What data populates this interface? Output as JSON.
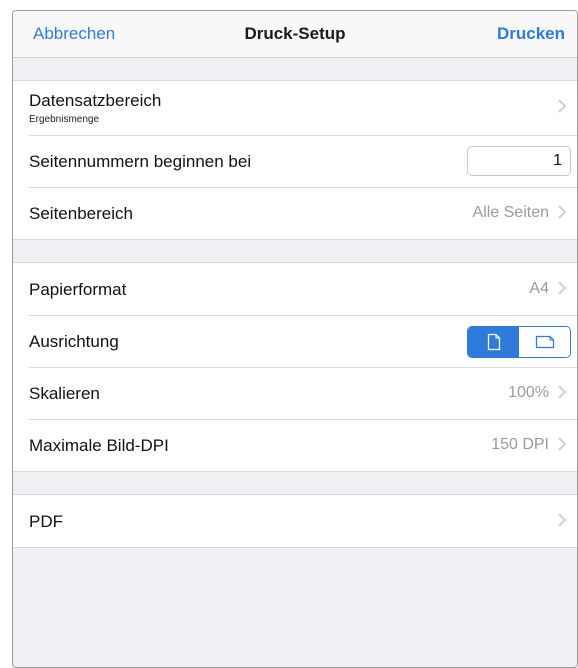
{
  "navbar": {
    "cancel_label": "Abbrechen",
    "title": "Druck-Setup",
    "print_label": "Drucken"
  },
  "section1": {
    "record_range": {
      "label": "Datensatzbereich",
      "sublabel": "Ergebnismenge"
    },
    "page_numbers_start": {
      "label": "Seitennummern beginnen bei",
      "value": "1"
    },
    "page_range": {
      "label": "Seitenbereich",
      "value": "Alle Seiten"
    }
  },
  "section2": {
    "paper_format": {
      "label": "Papierformat",
      "value": "A4"
    },
    "orientation": {
      "label": "Ausrichtung",
      "selected": "portrait",
      "options": [
        "portrait",
        "landscape"
      ]
    },
    "scale": {
      "label": "Skalieren",
      "value": "100%"
    },
    "max_image_dpi": {
      "label": "Maximale Bild-DPI",
      "value": "150 DPI"
    }
  },
  "section3": {
    "pdf": {
      "label": "PDF"
    }
  },
  "colors": {
    "accent": "#2f7bdc",
    "background": "#efeff4",
    "detail_text": "#9a9aa0"
  }
}
